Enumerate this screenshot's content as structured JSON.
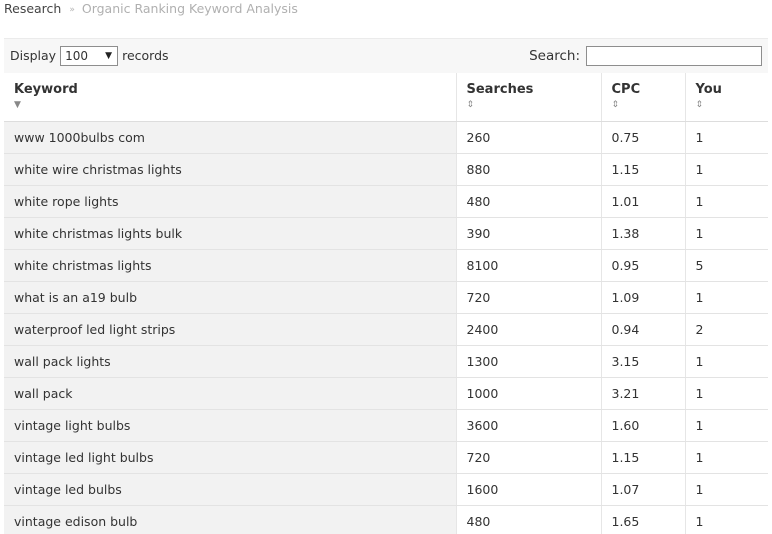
{
  "breadcrumb": {
    "first": "Research",
    "separator": "»",
    "current": "Organic Ranking Keyword Analysis"
  },
  "controls": {
    "display_label": "Display",
    "records_per_page": "100",
    "records_label": "records",
    "search_label": "Search:",
    "search_value": ""
  },
  "columns": [
    {
      "label": "Keyword",
      "sort": "descending"
    },
    {
      "label": "Searches",
      "sort": "both"
    },
    {
      "label": "CPC",
      "sort": "both"
    },
    {
      "label": "You",
      "sort": "both"
    }
  ],
  "rows": [
    [
      "www 1000bulbs com",
      "260",
      "0.75",
      "1"
    ],
    [
      "white wire christmas lights",
      "880",
      "1.15",
      "1"
    ],
    [
      "white rope lights",
      "480",
      "1.01",
      "1"
    ],
    [
      "white christmas lights bulk",
      "390",
      "1.38",
      "1"
    ],
    [
      "white christmas lights",
      "8100",
      "0.95",
      "5"
    ],
    [
      "what is an a19 bulb",
      "720",
      "1.09",
      "1"
    ],
    [
      "waterproof led light strips",
      "2400",
      "0.94",
      "2"
    ],
    [
      "wall pack lights",
      "1300",
      "3.15",
      "1"
    ],
    [
      "wall pack",
      "1000",
      "3.21",
      "1"
    ],
    [
      "vintage light bulbs",
      "3600",
      "1.60",
      "1"
    ],
    [
      "vintage led light bulbs",
      "720",
      "1.15",
      "1"
    ],
    [
      "vintage led bulbs",
      "1600",
      "1.07",
      "1"
    ],
    [
      "vintage edison bulb",
      "480",
      "1.65",
      "1"
    ]
  ]
}
